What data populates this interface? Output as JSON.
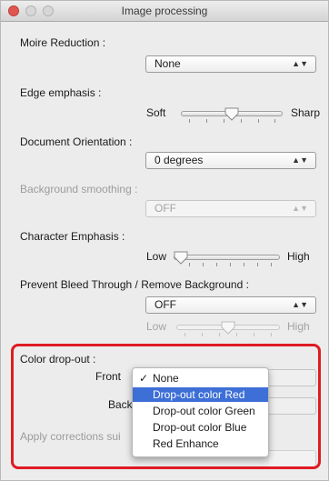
{
  "window": {
    "title": "Image processing"
  },
  "moire": {
    "label": "Moire Reduction :",
    "value": "None"
  },
  "edge": {
    "label": "Edge emphasis :",
    "min_label": "Soft",
    "max_label": "Sharp",
    "level": 0.5
  },
  "orientation": {
    "label": "Document Orientation :",
    "value": "0 degrees"
  },
  "smoothing": {
    "label": "Background smoothing :",
    "value": "OFF"
  },
  "character": {
    "label": "Character Emphasis :",
    "min_label": "Low",
    "max_label": "High",
    "level": 0.0
  },
  "bleed": {
    "label": "Prevent Bleed Through / Remove Background :",
    "value": "OFF",
    "min_label": "Low",
    "max_label": "High",
    "level": 0.5
  },
  "dropout": {
    "label": "Color drop-out :",
    "front_label": "Front",
    "back_label": "Back",
    "apply_label": "Apply corrections sui",
    "menu": [
      {
        "label": "None",
        "checked": true
      },
      {
        "label": "Drop-out color Red",
        "highlighted": true
      },
      {
        "label": "Drop-out color Green"
      },
      {
        "label": "Drop-out color Blue"
      },
      {
        "label": "Red Enhance"
      }
    ]
  },
  "colors": {
    "highlight": "#3d6fd6",
    "annotation": "#e01b24",
    "close": "#e0564f"
  }
}
